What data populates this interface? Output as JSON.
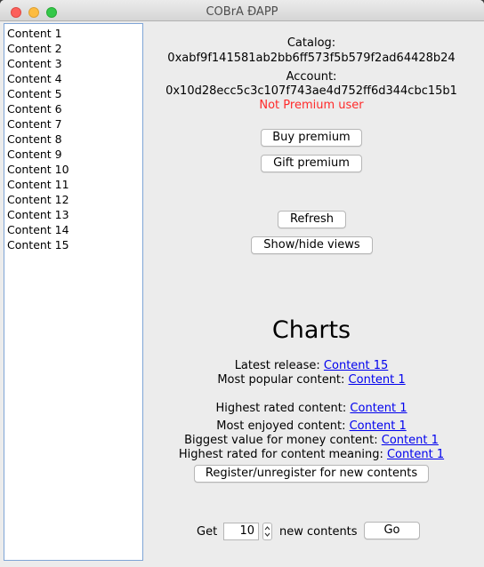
{
  "window": {
    "title": "COBrA ÐAPP"
  },
  "sidebar": {
    "items": [
      {
        "label": "Content 1"
      },
      {
        "label": "Content 2"
      },
      {
        "label": "Content 3"
      },
      {
        "label": "Content 4"
      },
      {
        "label": "Content 5"
      },
      {
        "label": "Content 6"
      },
      {
        "label": "Content 7"
      },
      {
        "label": "Content 8"
      },
      {
        "label": "Content 9"
      },
      {
        "label": "Content 10"
      },
      {
        "label": "Content 11"
      },
      {
        "label": "Content 12"
      },
      {
        "label": "Content 13"
      },
      {
        "label": "Content 14"
      },
      {
        "label": "Content 15"
      }
    ]
  },
  "info": {
    "catalog_label": "Catalog:",
    "catalog_address": "0xabf9f141581ab2bb6ff573f5b579f2ad64428b24",
    "account_label": "Account:",
    "account_address": "0x10d28ecc5c3c107f743ae4d752ff6d344cbc15b1",
    "premium_status": "Not Premium user",
    "premium_status_color": "#ff2a2a"
  },
  "buttons": {
    "buy_premium": "Buy premium",
    "gift_premium": "Gift premium",
    "refresh": "Refresh",
    "show_hide_views": "Show/hide views",
    "register": "Register/unregister for new contents",
    "go": "Go"
  },
  "charts": {
    "title": "Charts",
    "latest_release_label": "Latest release:",
    "latest_release_value": "Content 15",
    "most_popular_label": "Most popular content:",
    "most_popular_value": "Content 1",
    "highest_rated_label": "Highest rated content:",
    "highest_rated_value": "Content 1",
    "most_enjoyed_label": "Most enjoyed content:",
    "most_enjoyed_value": "Content 1",
    "biggest_value_label": "Biggest value for money content:",
    "biggest_value_value": "Content 1",
    "highest_meaning_label": "Highest rated for content meaning:",
    "highest_meaning_value": "Content 1"
  },
  "get_contents": {
    "get_label": "Get",
    "count": "10",
    "suffix_label": "new contents"
  }
}
